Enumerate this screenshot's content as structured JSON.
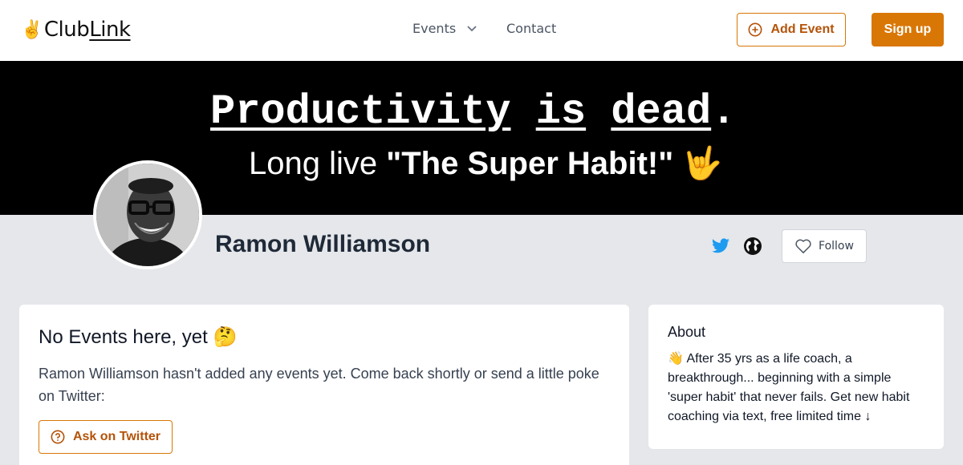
{
  "header": {
    "logo_emoji": "✌️",
    "logo_club": "Club",
    "logo_link": "Link",
    "nav_events": "Events",
    "nav_contact": "Contact",
    "add_event": "Add Event",
    "sign_up": "Sign up"
  },
  "banner": {
    "word1": "Productivity",
    "word2": "is",
    "word3": "dead",
    "period": ".",
    "line2_prefix": "Long live ",
    "line2_bold": "\"The Super Habit!\"",
    "line2_emoji": "🤟"
  },
  "profile": {
    "name": "Ramon Williamson",
    "follow_label": "Follow"
  },
  "events_card": {
    "title": "No Events here, yet 🤔",
    "message": "Ramon Williamson hasn't added any events yet. Come back shortly or send a little poke on Twitter:",
    "ask_button": "Ask on Twitter"
  },
  "about_card": {
    "title": "About",
    "text": "👋 After 35 yrs as a life coach, a breakthrough... beginning with a simple 'super habit' that never fails. Get new habit coaching via text, free limited time ↓"
  },
  "colors": {
    "accent": "#d97706",
    "twitter": "#1d9bf0"
  }
}
